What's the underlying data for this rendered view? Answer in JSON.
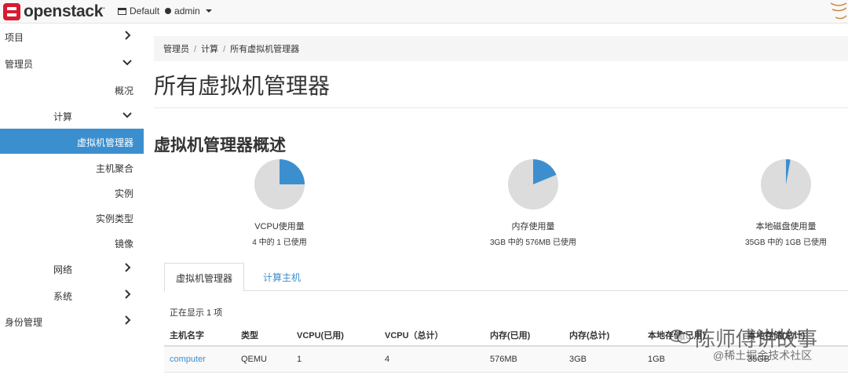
{
  "topbar": {
    "logo_text": "openstack",
    "logo_tm": ".",
    "domain": "Default",
    "user": "admin"
  },
  "sidebar": {
    "items": [
      {
        "label": "项目",
        "icon": "chevron-right-icon"
      },
      {
        "label": "管理员",
        "icon": "chevron-down-icon"
      },
      {
        "label": "概况"
      },
      {
        "label": "计算",
        "icon": "chevron-down-icon"
      },
      {
        "label": "虚拟机管理器",
        "active": true
      },
      {
        "label": "主机聚合"
      },
      {
        "label": "实例"
      },
      {
        "label": "实例类型"
      },
      {
        "label": "镜像"
      },
      {
        "label": "网络",
        "icon": "chevron-right-icon"
      },
      {
        "label": "系统",
        "icon": "chevron-right-icon"
      },
      {
        "label": "身份管理",
        "icon": "chevron-right-icon"
      }
    ]
  },
  "breadcrumb": [
    "管理员",
    "计算",
    "所有虚拟机管理器"
  ],
  "page_title": "所有虚拟机管理器",
  "section_title": "虚拟机管理器概述",
  "usage": [
    {
      "label": "VCPU使用量",
      "sub": "4 中的 1 已使用",
      "used_fraction": 0.25
    },
    {
      "label": "内存使用量",
      "sub": "3GB 中的 576MB 已使用",
      "used_fraction": 0.1875
    },
    {
      "label": "本地磁盘使用量",
      "sub": "35GB 中的 1GB 已使用",
      "used_fraction": 0.0286
    }
  ],
  "colors": {
    "used": "#3c8fcf",
    "free": "#dcdcdc",
    "accent": "#3c8fcf"
  },
  "tabs": [
    {
      "label": "虚拟机管理器",
      "active": true
    },
    {
      "label": "计算主机",
      "active": false
    }
  ],
  "showing_text": "正在显示 1 项",
  "table": {
    "headers": [
      "主机名字",
      "类型",
      "VCPU(已用)",
      "VCPU（总计）",
      "内存(已用)",
      "内存(总计)",
      "本地存储(已用)",
      "本地存储(总计)"
    ],
    "rows": [
      [
        "computer",
        "QEMU",
        "1",
        "4",
        "576MB",
        "3GB",
        "1GB",
        "35GB"
      ]
    ]
  },
  "watermark": {
    "line1": "陈师傅讲故事",
    "line2": "@稀土掘金技术社区"
  }
}
